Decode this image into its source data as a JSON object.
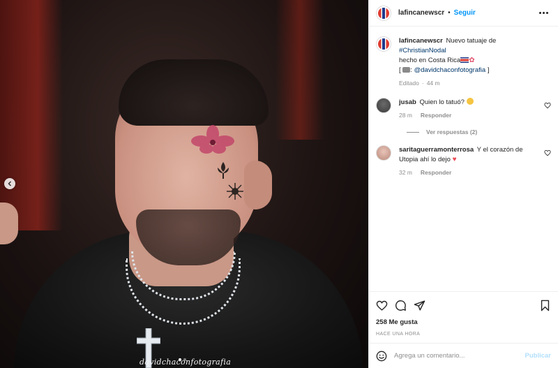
{
  "header": {
    "username": "lafincanewscr",
    "separator": "•",
    "follow_label": "Seguir"
  },
  "caption": {
    "username": "lafincanewscr",
    "text_1": "Nuevo tatuaje de",
    "hashtag": "#ChristianNodal",
    "text_2": "hecho en Costa Rica",
    "bracket_open": "[",
    "credit_sep": ":",
    "mention": "@davidchaconfotografia",
    "bracket_close": "]",
    "edited": "Editado",
    "edited_time": "44 m"
  },
  "comments": [
    {
      "username": "jusab",
      "text": "Quien lo tatuó?",
      "time": "28 m",
      "reply_label": "Responder",
      "view_replies": "Ver respuestas (2)"
    },
    {
      "username": "saritaguerramonterrosa",
      "text": "Y el corazón de Utopia ahí lo dejo",
      "time": "32 m",
      "reply_label": "Responder"
    }
  ],
  "photo": {
    "watermark": "davidchaconfotografia"
  },
  "actions": {
    "likes": "258 Me gusta",
    "posted": "HACE UNA HORA"
  },
  "add_comment": {
    "placeholder": "Agrega un comentario...",
    "post_label": "Publicar"
  },
  "icons": [
    "chevron-left-icon",
    "more-icon",
    "heart-icon",
    "comment-icon",
    "share-icon",
    "bookmark-icon",
    "emoji-icon"
  ],
  "colors": {
    "accent": "#0095f6",
    "link": "#00376b",
    "muted": "#8e8e8e",
    "post_disabled": "#b2dffc"
  }
}
